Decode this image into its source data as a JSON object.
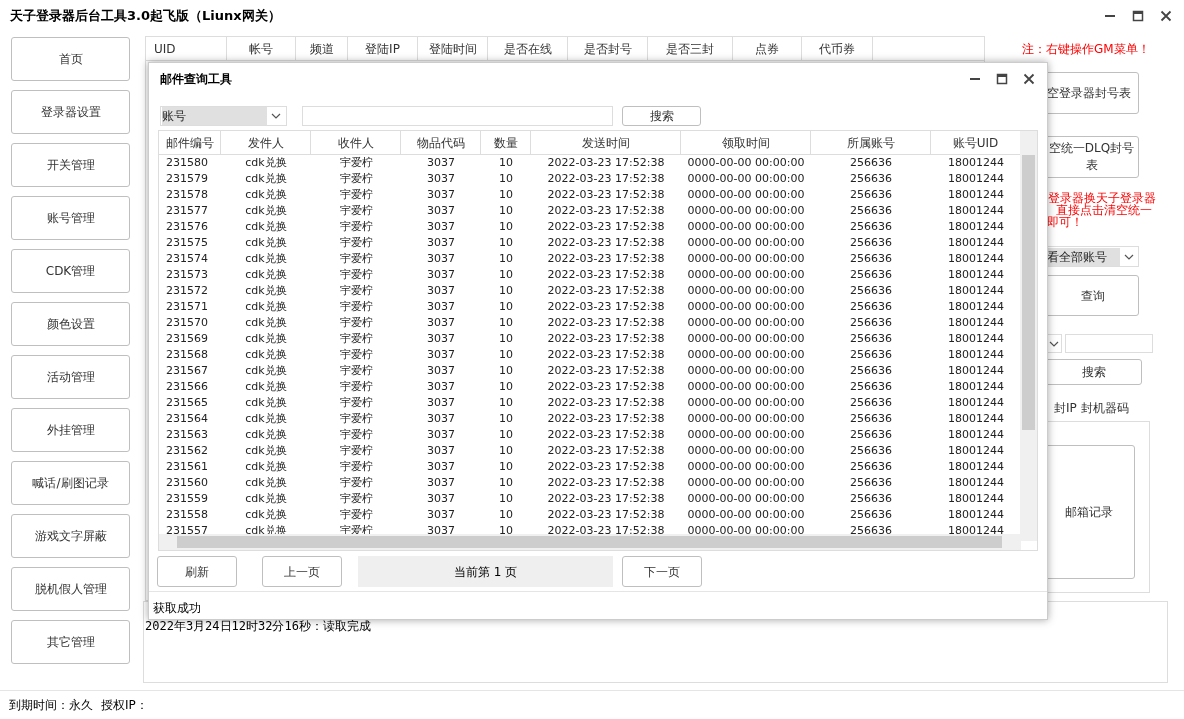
{
  "window": {
    "title": "天子登录器后台工具3.0起飞版（Liunx网关）"
  },
  "sidebar": {
    "items": [
      "首页",
      "登录器设置",
      "开关管理",
      "账号管理",
      "CDK管理",
      "颜色设置",
      "活动管理",
      "外挂管理",
      "喊话/刷图记录",
      "游戏文字屏蔽",
      "脱机假人管理",
      "其它管理"
    ]
  },
  "main_table": {
    "columns": [
      "UID",
      "帐号",
      "频道",
      "登陆IP",
      "登陆时间",
      "是否在线",
      "是否封号",
      "是否三封",
      "点券",
      "代币券"
    ]
  },
  "right_panel": {
    "note": "注：右键操作GM菜单！",
    "clear_ban_button": "空登录器封号表",
    "clear_dlq_button": "空统一DLQ封号表",
    "warning_lines": [
      "登录器换天子登录器",
      "直接点击清空统一",
      "即可！"
    ],
    "account_filter": "看全部账号",
    "query_button": "查询",
    "search_button": "搜索",
    "ban_options": "封IP 封机器码",
    "mail_button": "邮箱记录"
  },
  "log": [
    "2022年3月24日12时32分16秒：读取完成"
  ],
  "status_bar": {
    "expiry": "到期时间：永久",
    "ip_label": "授权IP："
  },
  "dialog": {
    "title": "邮件查询工具",
    "filter": "账号",
    "search_button": "搜索",
    "columns": [
      "邮件编号",
      "发件人",
      "收件人",
      "物品代码",
      "数量",
      "发送时间",
      "领取时间",
      "所属账号",
      "账号UID"
    ],
    "rows": [
      [
        "231580",
        "cdk兑换",
        "宇爱柠",
        "3037",
        "10",
        "2022-03-23 17:52:38",
        "0000-00-00 00:00:00",
        "256636",
        "18001244"
      ],
      [
        "231579",
        "cdk兑换",
        "宇爱柠",
        "3037",
        "10",
        "2022-03-23 17:52:38",
        "0000-00-00 00:00:00",
        "256636",
        "18001244"
      ],
      [
        "231578",
        "cdk兑换",
        "宇爱柠",
        "3037",
        "10",
        "2022-03-23 17:52:38",
        "0000-00-00 00:00:00",
        "256636",
        "18001244"
      ],
      [
        "231577",
        "cdk兑换",
        "宇爱柠",
        "3037",
        "10",
        "2022-03-23 17:52:38",
        "0000-00-00 00:00:00",
        "256636",
        "18001244"
      ],
      [
        "231576",
        "cdk兑换",
        "宇爱柠",
        "3037",
        "10",
        "2022-03-23 17:52:38",
        "0000-00-00 00:00:00",
        "256636",
        "18001244"
      ],
      [
        "231575",
        "cdk兑换",
        "宇爱柠",
        "3037",
        "10",
        "2022-03-23 17:52:38",
        "0000-00-00 00:00:00",
        "256636",
        "18001244"
      ],
      [
        "231574",
        "cdk兑换",
        "宇爱柠",
        "3037",
        "10",
        "2022-03-23 17:52:38",
        "0000-00-00 00:00:00",
        "256636",
        "18001244"
      ],
      [
        "231573",
        "cdk兑换",
        "宇爱柠",
        "3037",
        "10",
        "2022-03-23 17:52:38",
        "0000-00-00 00:00:00",
        "256636",
        "18001244"
      ],
      [
        "231572",
        "cdk兑换",
        "宇爱柠",
        "3037",
        "10",
        "2022-03-23 17:52:38",
        "0000-00-00 00:00:00",
        "256636",
        "18001244"
      ],
      [
        "231571",
        "cdk兑换",
        "宇爱柠",
        "3037",
        "10",
        "2022-03-23 17:52:38",
        "0000-00-00 00:00:00",
        "256636",
        "18001244"
      ],
      [
        "231570",
        "cdk兑换",
        "宇爱柠",
        "3037",
        "10",
        "2022-03-23 17:52:38",
        "0000-00-00 00:00:00",
        "256636",
        "18001244"
      ],
      [
        "231569",
        "cdk兑换",
        "宇爱柠",
        "3037",
        "10",
        "2022-03-23 17:52:38",
        "0000-00-00 00:00:00",
        "256636",
        "18001244"
      ],
      [
        "231568",
        "cdk兑换",
        "宇爱柠",
        "3037",
        "10",
        "2022-03-23 17:52:38",
        "0000-00-00 00:00:00",
        "256636",
        "18001244"
      ],
      [
        "231567",
        "cdk兑换",
        "宇爱柠",
        "3037",
        "10",
        "2022-03-23 17:52:38",
        "0000-00-00 00:00:00",
        "256636",
        "18001244"
      ],
      [
        "231566",
        "cdk兑换",
        "宇爱柠",
        "3037",
        "10",
        "2022-03-23 17:52:38",
        "0000-00-00 00:00:00",
        "256636",
        "18001244"
      ],
      [
        "231565",
        "cdk兑换",
        "宇爱柠",
        "3037",
        "10",
        "2022-03-23 17:52:38",
        "0000-00-00 00:00:00",
        "256636",
        "18001244"
      ],
      [
        "231564",
        "cdk兑换",
        "宇爱柠",
        "3037",
        "10",
        "2022-03-23 17:52:38",
        "0000-00-00 00:00:00",
        "256636",
        "18001244"
      ],
      [
        "231563",
        "cdk兑换",
        "宇爱柠",
        "3037",
        "10",
        "2022-03-23 17:52:38",
        "0000-00-00 00:00:00",
        "256636",
        "18001244"
      ],
      [
        "231562",
        "cdk兑换",
        "宇爱柠",
        "3037",
        "10",
        "2022-03-23 17:52:38",
        "0000-00-00 00:00:00",
        "256636",
        "18001244"
      ],
      [
        "231561",
        "cdk兑换",
        "宇爱柠",
        "3037",
        "10",
        "2022-03-23 17:52:38",
        "0000-00-00 00:00:00",
        "256636",
        "18001244"
      ],
      [
        "231560",
        "cdk兑换",
        "宇爱柠",
        "3037",
        "10",
        "2022-03-23 17:52:38",
        "0000-00-00 00:00:00",
        "256636",
        "18001244"
      ],
      [
        "231559",
        "cdk兑换",
        "宇爱柠",
        "3037",
        "10",
        "2022-03-23 17:52:38",
        "0000-00-00 00:00:00",
        "256636",
        "18001244"
      ],
      [
        "231558",
        "cdk兑换",
        "宇爱柠",
        "3037",
        "10",
        "2022-03-23 17:52:38",
        "0000-00-00 00:00:00",
        "256636",
        "18001244"
      ],
      [
        "231557",
        "cdk兑换",
        "宇爱柠",
        "3037",
        "10",
        "2022-03-23 17:52:38",
        "0000-00-00 00:00:00",
        "256636",
        "18001244"
      ]
    ],
    "refresh_button": "刷新",
    "prev_button": "上一页",
    "page_label": "当前第 1 页",
    "next_button": "下一页",
    "status": "获取成功"
  }
}
